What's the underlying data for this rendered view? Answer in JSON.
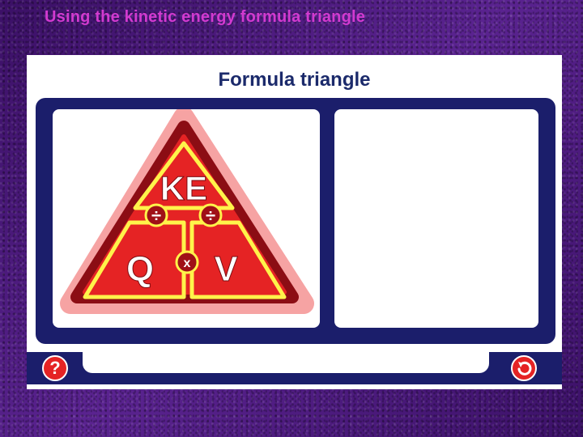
{
  "slide": {
    "title": "Using the kinetic energy formula triangle"
  },
  "panel": {
    "heading": "Formula triangle"
  },
  "triangle": {
    "top_label": "KE",
    "left_label": "Q",
    "right_label": "V",
    "divide_symbol": "÷",
    "multiply_symbol": "x"
  },
  "footer": {
    "help_icon": "question-mark-icon",
    "back_icon": "back-arrow-icon"
  },
  "colors": {
    "navy": "#1b1e6b",
    "red": "#e52324",
    "yellow": "#fff34a",
    "title_magenta": "#d23ad0"
  }
}
